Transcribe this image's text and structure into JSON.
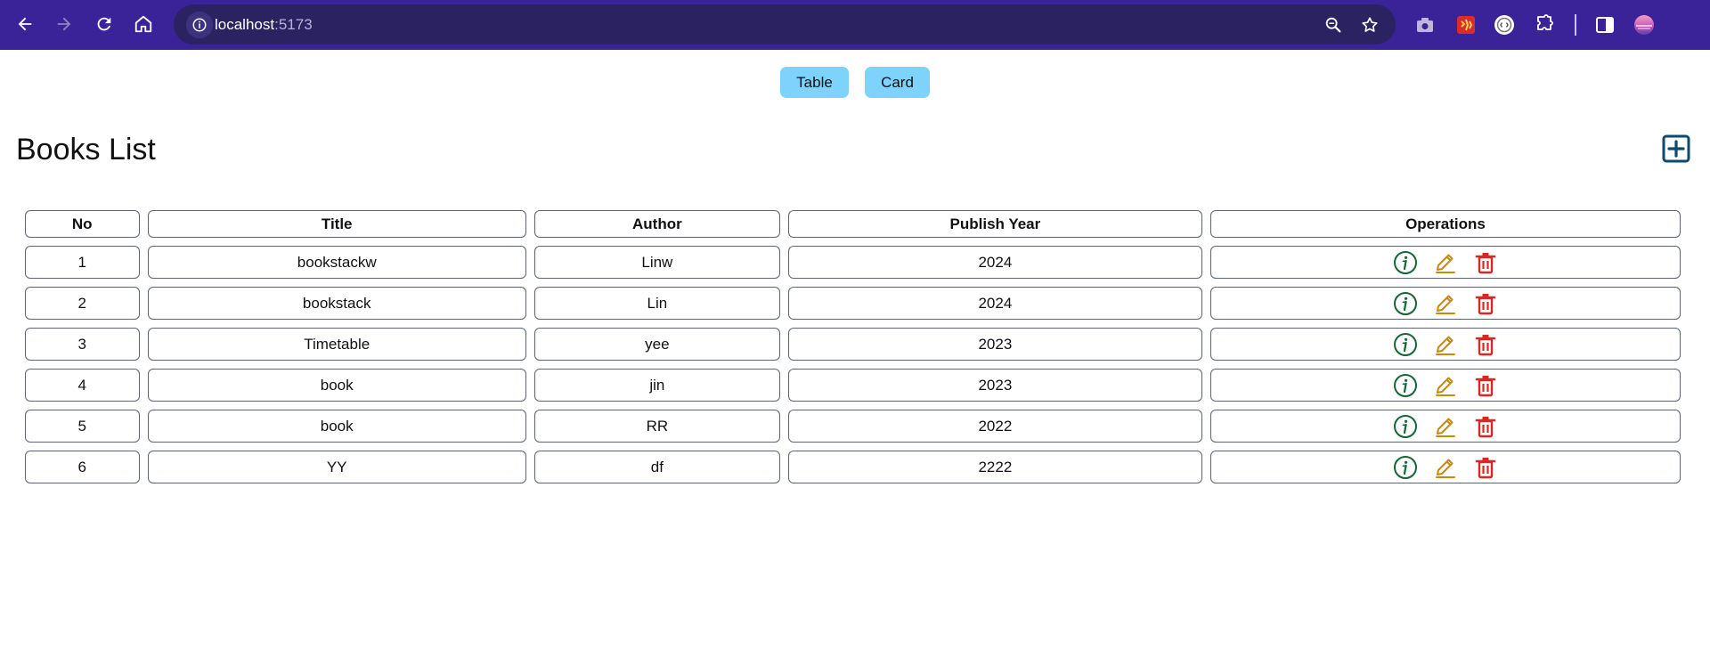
{
  "browser": {
    "url_host": "localhost",
    "url_port": ":5173",
    "icons": [
      "back-icon",
      "forward-icon",
      "reload-icon",
      "home-icon",
      "site-info-icon",
      "zoom-icon",
      "star-icon",
      "camera-icon",
      "extension-icon",
      "vpn-icon",
      "puzzle-icon",
      "sidepanel-icon",
      "profile-avatar"
    ]
  },
  "view_switch": {
    "table_label": "Table",
    "card_label": "Card"
  },
  "page": {
    "title": "Books List",
    "add_icon": "plus-square-icon"
  },
  "table": {
    "headers": {
      "no": "No",
      "title": "Title",
      "author": "Author",
      "year": "Publish Year",
      "ops": "Operations"
    },
    "rows": [
      {
        "no": "1",
        "title": "bookstackw",
        "author": "Linw",
        "year": "2024"
      },
      {
        "no": "2",
        "title": "bookstack",
        "author": "Lin",
        "year": "2024"
      },
      {
        "no": "3",
        "title": "Timetable",
        "author": "yee",
        "year": "2023"
      },
      {
        "no": "4",
        "title": "book",
        "author": "jin",
        "year": "2023"
      },
      {
        "no": "5",
        "title": "book",
        "author": "RR",
        "year": "2022"
      },
      {
        "no": "6",
        "title": "YY",
        "author": "df",
        "year": "2222"
      }
    ],
    "operation_icons": [
      "info-circle-icon",
      "edit-pencil-icon",
      "delete-trash-icon"
    ]
  },
  "colors": {
    "chrome_bg": "#3a2399",
    "omnibox_bg": "#2b2261",
    "switch_button": "#7dd3fc",
    "add_icon": "#0c4a6e",
    "info_icon": "#166534",
    "edit_icon": "#ca8a04",
    "delete_icon": "#dc2626"
  }
}
